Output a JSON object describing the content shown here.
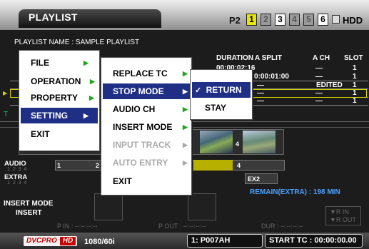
{
  "header": {
    "title": "PLAYLIST",
    "p2": "P2",
    "slots": [
      "1",
      "2",
      "3",
      "4",
      "5",
      "6"
    ],
    "hdd": "HDD"
  },
  "playlist": {
    "name_line": "PLAYLIST NAME  :  SAMPLE PLAYLIST",
    "columns": {
      "duration": "DURATION",
      "a_split": "A SPLIT",
      "a_ch": "A CH",
      "slot": "SLOT"
    },
    "rows": [
      {
        "duration": "00:00:02:16",
        "a_split": "",
        "a_ch": "—",
        "slot": "1"
      },
      {
        "duration": "",
        "a_split": "0:00:01:00",
        "a_ch": "—",
        "slot": "1"
      },
      {
        "duration": "",
        "a_split": "—",
        "a_ch": "EDITED",
        "slot": "1"
      },
      {
        "duration": "",
        "a_split": "—",
        "a_ch": "—",
        "slot": "1"
      },
      {
        "duration": "",
        "a_split": "—",
        "a_ch": "—",
        "slot": "1"
      }
    ],
    "t_mark": "T"
  },
  "timeline": {
    "audio_label": "AUDIO",
    "audio_channels": "1 2 3 4",
    "extra_label": "EXTRA",
    "extra_channels": "1 2 3 4",
    "video_num": "4",
    "audio_nums": [
      "1",
      "2",
      "4"
    ],
    "extra_clip": "EX2",
    "remain": "REMAIN(EXTRA) : 198 MIN"
  },
  "insert": {
    "label": "INSERT MODE",
    "value": "INSERT"
  },
  "points": {
    "p_in": "P IN : --:--:--:--",
    "p_out": "P OUT : --:--:--:--",
    "dur": "DUR : --:--:--:--",
    "r_in": "▼R IN",
    "r_out": "▼R OUT"
  },
  "footer": {
    "dvcpro": "DVCPRO",
    "hd": "HD",
    "format": "1080/60i",
    "clip": "1: P007AH",
    "start_tc": "START TC    : 00:00:00.00"
  },
  "menu_main": {
    "items": [
      {
        "label": "FILE",
        "arrow": "▶"
      },
      {
        "label": "OPERATION",
        "arrow": "▶"
      },
      {
        "label": "PROPERTY",
        "arrow": "▶"
      },
      {
        "label": "SETTING",
        "arrow": "▶",
        "selected": true
      },
      {
        "label": "EXIT",
        "arrow": ""
      }
    ]
  },
  "menu_setting": {
    "items": [
      {
        "label": "REPLACE TC",
        "arrow": "▶"
      },
      {
        "label": "STOP MODE",
        "arrow": "▶",
        "selected": true
      },
      {
        "label": "AUDIO CH",
        "arrow": "▶"
      },
      {
        "label": "INSERT MODE",
        "arrow": "▶"
      },
      {
        "label": "INPUT TRACK",
        "arrow": "▶",
        "disabled": true
      },
      {
        "label": "AUTO ENTRY",
        "arrow": "▶",
        "disabled": true
      },
      {
        "label": "EXIT",
        "arrow": ""
      }
    ]
  },
  "menu_stop": {
    "items": [
      {
        "label": "RETURN",
        "check": "✓",
        "selected": true
      },
      {
        "label": "STAY",
        "check": ""
      }
    ]
  },
  "colors": {
    "menu_select": "#1f2f86",
    "submenu_arrow": "#1fa51f",
    "active_slot": "#e6e600",
    "remain_text": "#4aa0ff"
  }
}
